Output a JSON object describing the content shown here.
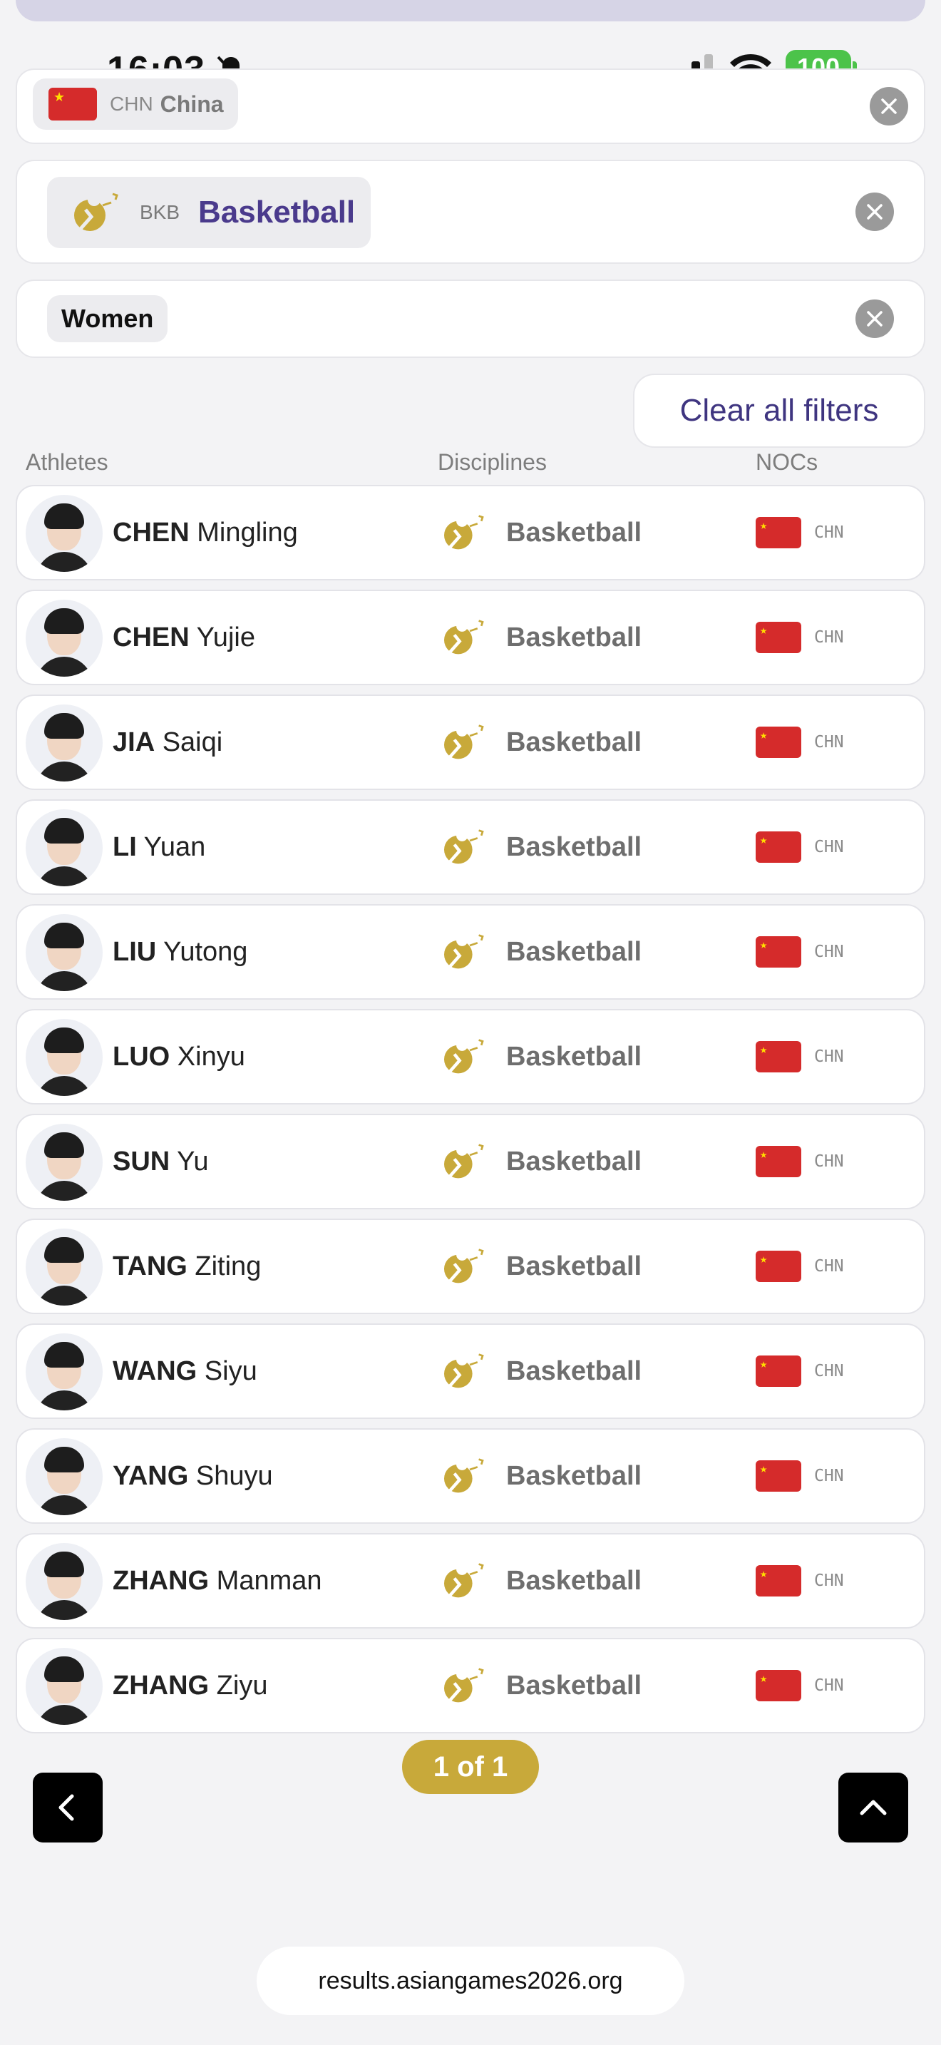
{
  "status_bar": {
    "time": "16:03",
    "battery": "100"
  },
  "filters": {
    "country": {
      "code": "CHN",
      "name": "China"
    },
    "sport": {
      "code": "BKB",
      "name": "Basketball"
    },
    "gender": {
      "name": "Women"
    }
  },
  "clear_all_label": "Clear all filters",
  "columns": {
    "athletes": "Athletes",
    "disciplines": "Disciplines",
    "nocs": "NOCs"
  },
  "athletes": [
    {
      "last": "CHEN",
      "first": "Mingling",
      "discipline": "Basketball",
      "noc": "CHN"
    },
    {
      "last": "CHEN",
      "first": "Yujie",
      "discipline": "Basketball",
      "noc": "CHN"
    },
    {
      "last": "JIA",
      "first": "Saiqi",
      "discipline": "Basketball",
      "noc": "CHN"
    },
    {
      "last": "LI",
      "first": "Yuan",
      "discipline": "Basketball",
      "noc": "CHN"
    },
    {
      "last": "LIU",
      "first": "Yutong",
      "discipline": "Basketball",
      "noc": "CHN"
    },
    {
      "last": "LUO",
      "first": "Xinyu",
      "discipline": "Basketball",
      "noc": "CHN"
    },
    {
      "last": "SUN",
      "first": "Yu",
      "discipline": "Basketball",
      "noc": "CHN"
    },
    {
      "last": "TANG",
      "first": "Ziting",
      "discipline": "Basketball",
      "noc": "CHN"
    },
    {
      "last": "WANG",
      "first": "Siyu",
      "discipline": "Basketball",
      "noc": "CHN"
    },
    {
      "last": "YANG",
      "first": "Shuyu",
      "discipline": "Basketball",
      "noc": "CHN"
    },
    {
      "last": "ZHANG",
      "first": "Manman",
      "discipline": "Basketball",
      "noc": "CHN"
    },
    {
      "last": "ZHANG",
      "first": "Ziyu",
      "discipline": "Basketball",
      "noc": "CHN"
    }
  ],
  "pagination": {
    "label": "1 of 1"
  },
  "url": "results.asiangames2026.org",
  "colors": {
    "accent_purple": "#4a3a8c",
    "gold": "#c8a93a",
    "flag_red": "#d52b2b",
    "battery_green": "#4cc34a"
  },
  "icons": {
    "sport": "basketball-pictogram-icon",
    "close": "close-icon",
    "back": "chevron-left-icon",
    "top": "chevron-up-icon"
  }
}
